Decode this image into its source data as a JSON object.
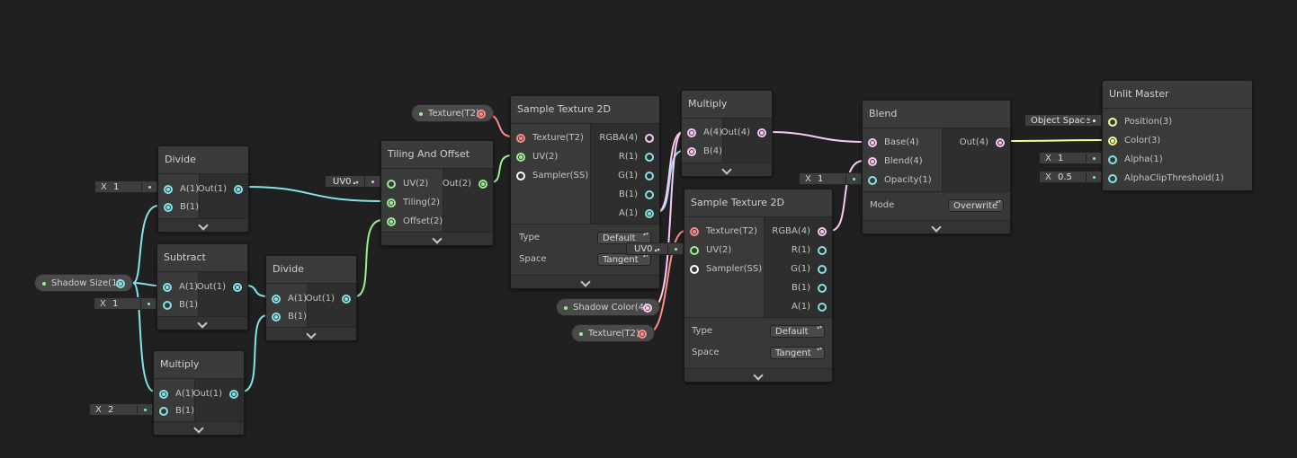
{
  "colors": {
    "float_port": "#84e4e7",
    "vector2_port": "#9aef92",
    "vector3_port": "#f6ff9a",
    "vector4_port": "#fbcbf4",
    "texture_port": "#ff8b8b",
    "sampler_port": "#ffffff",
    "canvas": "#202020",
    "node_body": "#383838"
  },
  "icons": {
    "collapse": "chevron-down-icon",
    "dropdown": "up-down-arrows-icon",
    "port": "circle-port-icon"
  },
  "nodes": {
    "divide_a": {
      "title": "Divide",
      "inputs": [
        "A(1)",
        "B(1)"
      ],
      "outputs": [
        "Out(1)"
      ],
      "inline_x": "X",
      "inline_value": "1"
    },
    "subtract": {
      "title": "Subtract",
      "inputs": [
        "A(1)",
        "B(1)"
      ],
      "outputs": [
        "Out(1)"
      ],
      "inline_x": "X",
      "inline_value": "1"
    },
    "multiply_a": {
      "title": "Multiply",
      "inputs": [
        "A(1)",
        "B(1)"
      ],
      "outputs": [
        "Out(1)"
      ],
      "inline_x": "X",
      "inline_value": "2"
    },
    "divide_b": {
      "title": "Divide",
      "inputs": [
        "A(1)",
        "B(1)"
      ],
      "outputs": [
        "Out(1)"
      ]
    },
    "tiling": {
      "title": "Tiling And Offset",
      "inputs": [
        "UV(2)",
        "Tiling(2)",
        "Offset(2)"
      ],
      "outputs": [
        "Out(2)"
      ],
      "inline_uv": "UV0"
    },
    "sample_a": {
      "title": "Sample Texture 2D",
      "inputs": [
        "Texture(T2)",
        "UV(2)",
        "Sampler(SS)"
      ],
      "outputs": [
        "RGBA(4)",
        "R(1)",
        "G(1)",
        "B(1)",
        "A(1)"
      ],
      "type_label": "Type",
      "type_value": "Default",
      "space_label": "Space",
      "space_value": "Tangent"
    },
    "multiply_b": {
      "title": "Multiply",
      "inputs": [
        "A(4)",
        "B(4)"
      ],
      "outputs": [
        "Out(4)"
      ]
    },
    "sample_b": {
      "title": "Sample Texture 2D",
      "inputs": [
        "Texture(T2)",
        "UV(2)",
        "Sampler(SS)"
      ],
      "outputs": [
        "RGBA(4)",
        "R(1)",
        "G(1)",
        "B(1)",
        "A(1)"
      ],
      "type_label": "Type",
      "type_value": "Default",
      "space_label": "Space",
      "space_value": "Tangent",
      "inline_uv": "UV0"
    },
    "blend": {
      "title": "Blend",
      "inputs": [
        "Base(4)",
        "Blend(4)",
        "Opacity(1)"
      ],
      "outputs": [
        "Out(4)"
      ],
      "mode_label": "Mode",
      "mode_value": "Overwrite",
      "inline_x": "X",
      "inline_value": "1"
    },
    "master": {
      "title": "Unlit Master",
      "inputs": [
        "Position(3)",
        "Color(3)",
        "Alpha(1)",
        "AlphaClipThreshold(1)"
      ],
      "inline_space": "Object Space",
      "alpha_x": "X",
      "alpha_value": "1",
      "clip_x": "X",
      "clip_value": "0.5"
    }
  },
  "properties": {
    "shadow_size": "Shadow Size(1)",
    "texture_top": "Texture(T2)",
    "shadow_color": "Shadow Color(4)",
    "texture_bottom": "Texture(T2)"
  }
}
